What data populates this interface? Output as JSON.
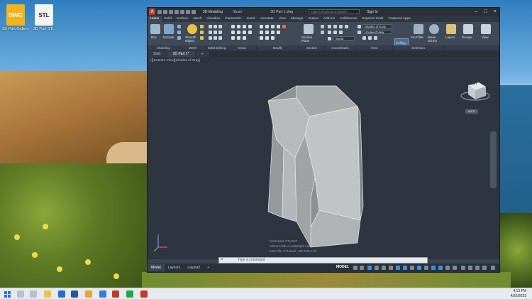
{
  "desktop": {
    "icons": [
      {
        "badge": "DWG",
        "label": "3D Part Gallery"
      },
      {
        "badge": "STL",
        "label": "3D Part STL"
      }
    ]
  },
  "titlebar": {
    "logo": "A",
    "workspace": "3D Modeling",
    "share": "Share",
    "drawing_title": "3D Part 1.dwg",
    "search_placeholder": "Type a keyword or phrase",
    "signin": "Sign In"
  },
  "ribbon_tabs": [
    "Home",
    "Solid",
    "Surface",
    "Mesh",
    "Visualize",
    "Parametric",
    "Insert",
    "Annotate",
    "View",
    "Manage",
    "Output",
    "Add-ins",
    "Collaborate",
    "Express Tools",
    "Featured Apps"
  ],
  "ribbon": {
    "box": "Box",
    "extrude": "Extrude",
    "smooth_object": "Smooth Object",
    "section_plane": "Section Plane",
    "culling": "Culling",
    "no_filter": "No Filter",
    "move_gizmo": "Move Gizmo",
    "layers": "Layers",
    "groups": "Groups",
    "view": "View",
    "visual_style": "Shades of Gray",
    "unsaved_view": "Unsaved View",
    "world": "World",
    "panels": [
      "Modeling",
      "Mesh",
      "Solid Editing",
      "Draw",
      "Modify",
      "Section",
      "Coordinates",
      "View",
      "Selection"
    ]
  },
  "doc_tabs": [
    "Start",
    "3D Part 1*"
  ],
  "viewport": {
    "label": "[-][Custom View][Shades of Gray]",
    "viewcube_face": "LEFT",
    "wcs": "WCS",
    "history": [
      "Command: STLOUT",
      "Select solids or watertight meshes:",
      "Enter file: C:\\Users\\...\\3D Part 1.stl"
    ]
  },
  "command": {
    "placeholder": "Type a command"
  },
  "layout_tabs": [
    "Model",
    "Layout1",
    "Layout2"
  ],
  "status": {
    "model": "MODEL"
  },
  "taskbar": {
    "time": "4:13 PM",
    "date": "4/25/2023"
  }
}
